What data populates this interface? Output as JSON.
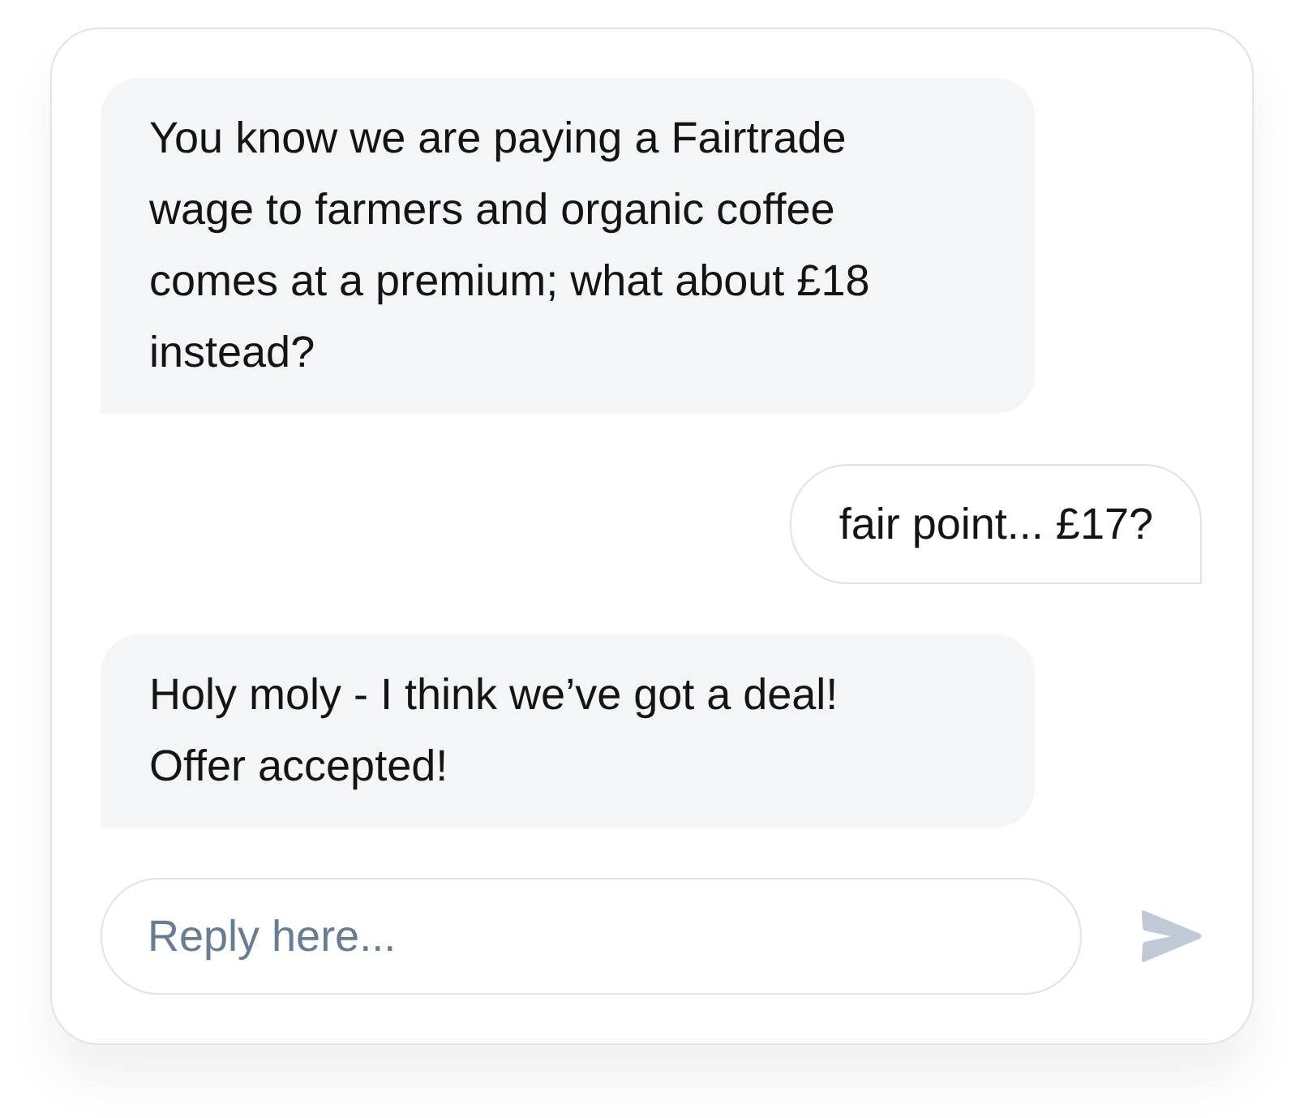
{
  "messages": [
    {
      "kind": "incoming",
      "text": "You know we are paying a Fairtrade wage to farmers and organic coffee comes at a premium; what about £18 instead?"
    },
    {
      "kind": "outgoing",
      "text": "fair point... £17?"
    },
    {
      "kind": "incoming",
      "text": "Holy moly - I think we’ve got a deal! Offer accepted!"
    }
  ],
  "composer": {
    "placeholder": "Reply here..."
  }
}
